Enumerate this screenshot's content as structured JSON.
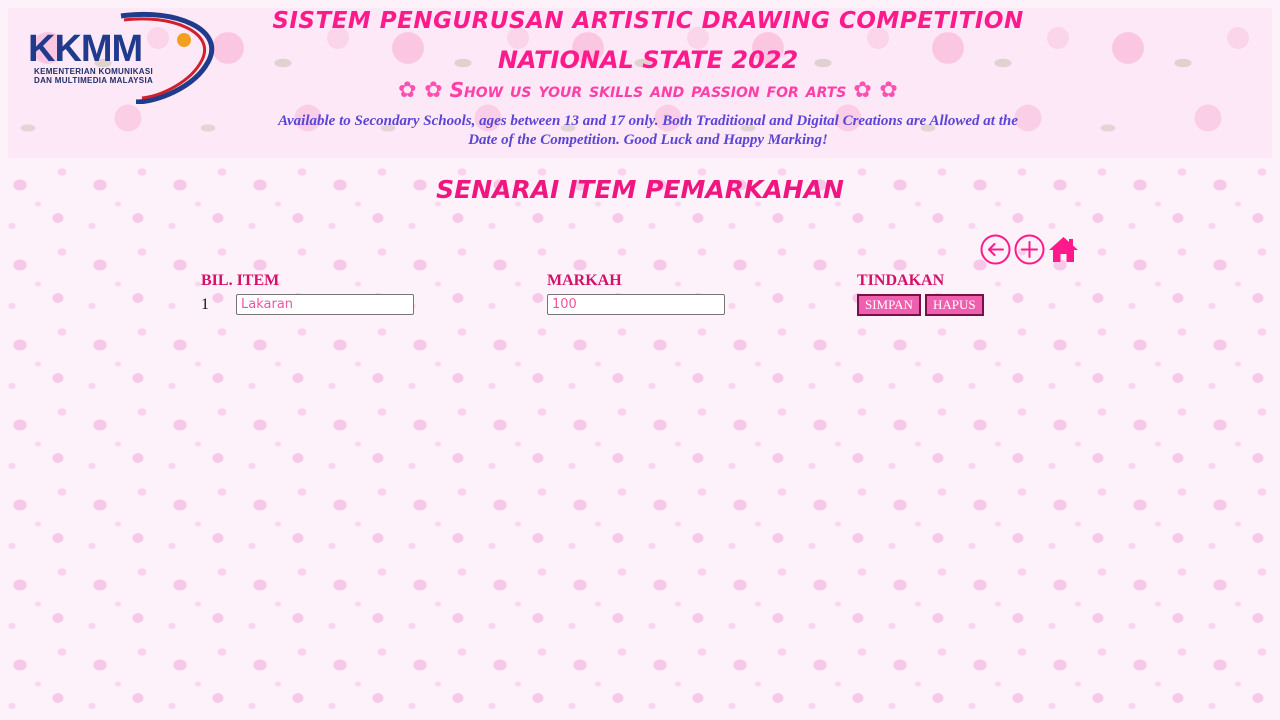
{
  "header": {
    "logo": {
      "text": "KKMM",
      "sub_line_1": "KEMENTERIAN KOMUNIKASI",
      "sub_line_2": "DAN MULTIMEDIA MALAYSIA"
    },
    "title_line_1": "SISTEM PENGURUSAN ARTISTIC DRAWING COMPETITION",
    "title_line_2": "NATIONAL STATE 2022",
    "tagline": "Show us your skills and passion for arts",
    "info_line_1": "Available to Secondary Schools, ages between 13 and 17 only. Both Traditional and Digital Creations are Allowed at the",
    "info_line_2": "Date of the Competition. Good Luck and Happy Marking!"
  },
  "page": {
    "title": "SENARAI ITEM PEMARKAHAN"
  },
  "toolbar": {
    "icons": [
      "back-arrow-icon",
      "add-icon",
      "home-icon"
    ]
  },
  "table": {
    "columns": [
      "BIL. ITEM",
      "MARKAH",
      "TINDAKAN"
    ],
    "rows": [
      {
        "number": "1",
        "item": "Lakaran",
        "mark": "100",
        "save_label": "SIMPAN",
        "delete_label": "HAPUS"
      }
    ]
  },
  "colors": {
    "accent": "#ff1a8c",
    "info_text": "#5a45d6",
    "button_bg": "#ee5fae",
    "logo_blue": "#203a8c"
  }
}
